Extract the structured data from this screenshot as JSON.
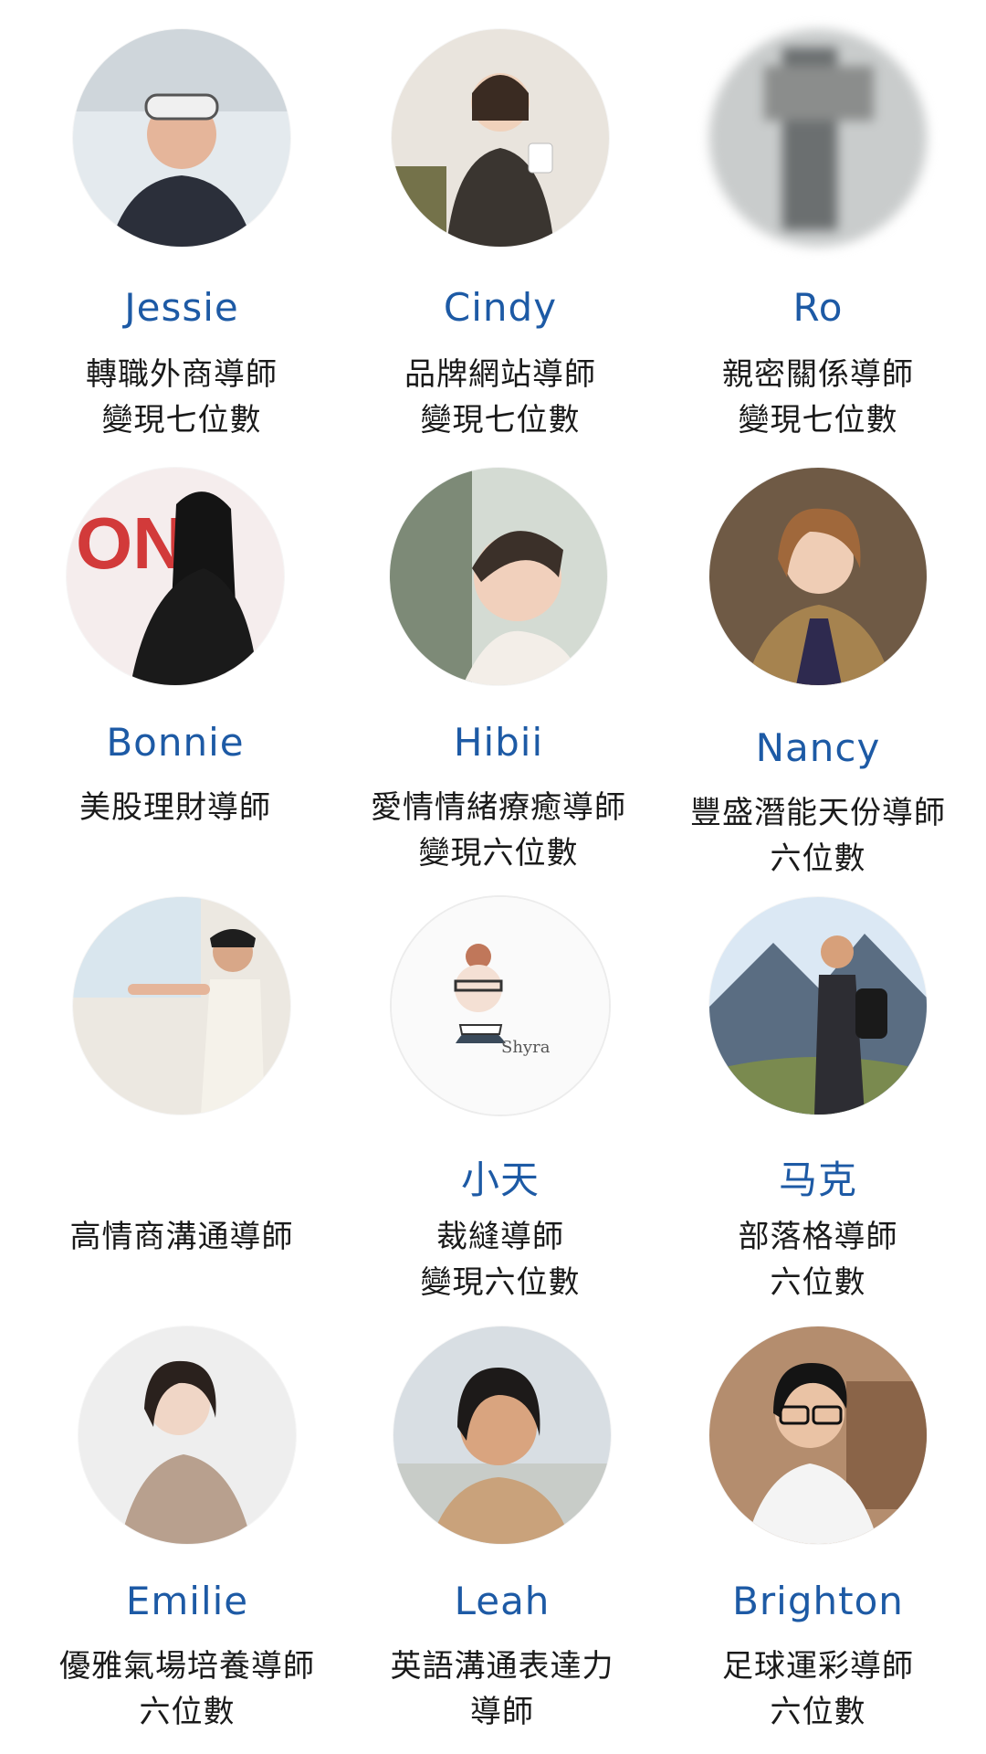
{
  "mentors": [
    {
      "name": "Jessie",
      "line1": "轉職外商導師",
      "line2": "變現七位數",
      "avatar_bg": "#dfe6ea",
      "avatar_fg": "#2b2f3a",
      "avatar_icon": "person-photo-icon"
    },
    {
      "name": "Cindy",
      "line1": "品牌網站導師",
      "line2": "變現七位數",
      "avatar_bg": "#e6e1da",
      "avatar_fg": "#3a3530",
      "avatar_icon": "person-photo-icon"
    },
    {
      "name": "Ro",
      "line1": "親密關係導師",
      "line2": "變現七位數",
      "avatar_bg": "#c9cccc",
      "avatar_fg": "#6b6f70",
      "avatar_icon": "blurred-photo-icon"
    },
    {
      "name": "Bonnie",
      "line1": "美股理財導師",
      "line2": "",
      "avatar_bg": "#f3e9e9",
      "avatar_fg": "#1a1a1a",
      "avatar_icon": "person-photo-icon"
    },
    {
      "name": "Hibii",
      "line1": "愛情情緒療癒導師",
      "line2": "變現六位數",
      "avatar_bg": "#d9ddd6",
      "avatar_fg": "#3b3029",
      "avatar_icon": "person-photo-icon"
    },
    {
      "name": "Nancy",
      "line1": "豐盛潛能天份導師",
      "line2": "六位數",
      "avatar_bg": "#8a6a4f",
      "avatar_fg": "#2e2a4f",
      "avatar_icon": "person-photo-icon"
    },
    {
      "name": "",
      "line1": "高情商溝通導師",
      "line2": "",
      "avatar_bg": "#e9e6df",
      "avatar_fg": "#2a2a2a",
      "avatar_icon": "person-photo-icon"
    },
    {
      "name": "小天",
      "line1": "裁縫導師",
      "line2": "變現六位數",
      "avatar_bg": "#fafafa",
      "avatar_fg": "#c0775a",
      "avatar_icon": "illustration-icon"
    },
    {
      "name": "马克",
      "line1": "部落格導師",
      "line2": "六位數",
      "avatar_bg": "#cfe0ef",
      "avatar_fg": "#2d2d33",
      "avatar_icon": "person-photo-icon"
    },
    {
      "name": "Emilie",
      "line1": "優雅氣場培養導師",
      "line2": "六位數",
      "avatar_bg": "#eeeeee",
      "avatar_fg": "#2a211d",
      "avatar_icon": "person-photo-icon"
    },
    {
      "name": "Leah",
      "line1": "英語溝通表達力",
      "line2": "導師",
      "avatar_bg": "#d8dee3",
      "avatar_fg": "#1d1a19",
      "avatar_icon": "person-photo-icon"
    },
    {
      "name": "Brighton",
      "line1": "足球運彩導師",
      "line2": "六位數",
      "avatar_bg": "#a9866a",
      "avatar_fg": "#1a1a1a",
      "avatar_icon": "person-photo-icon"
    }
  ]
}
